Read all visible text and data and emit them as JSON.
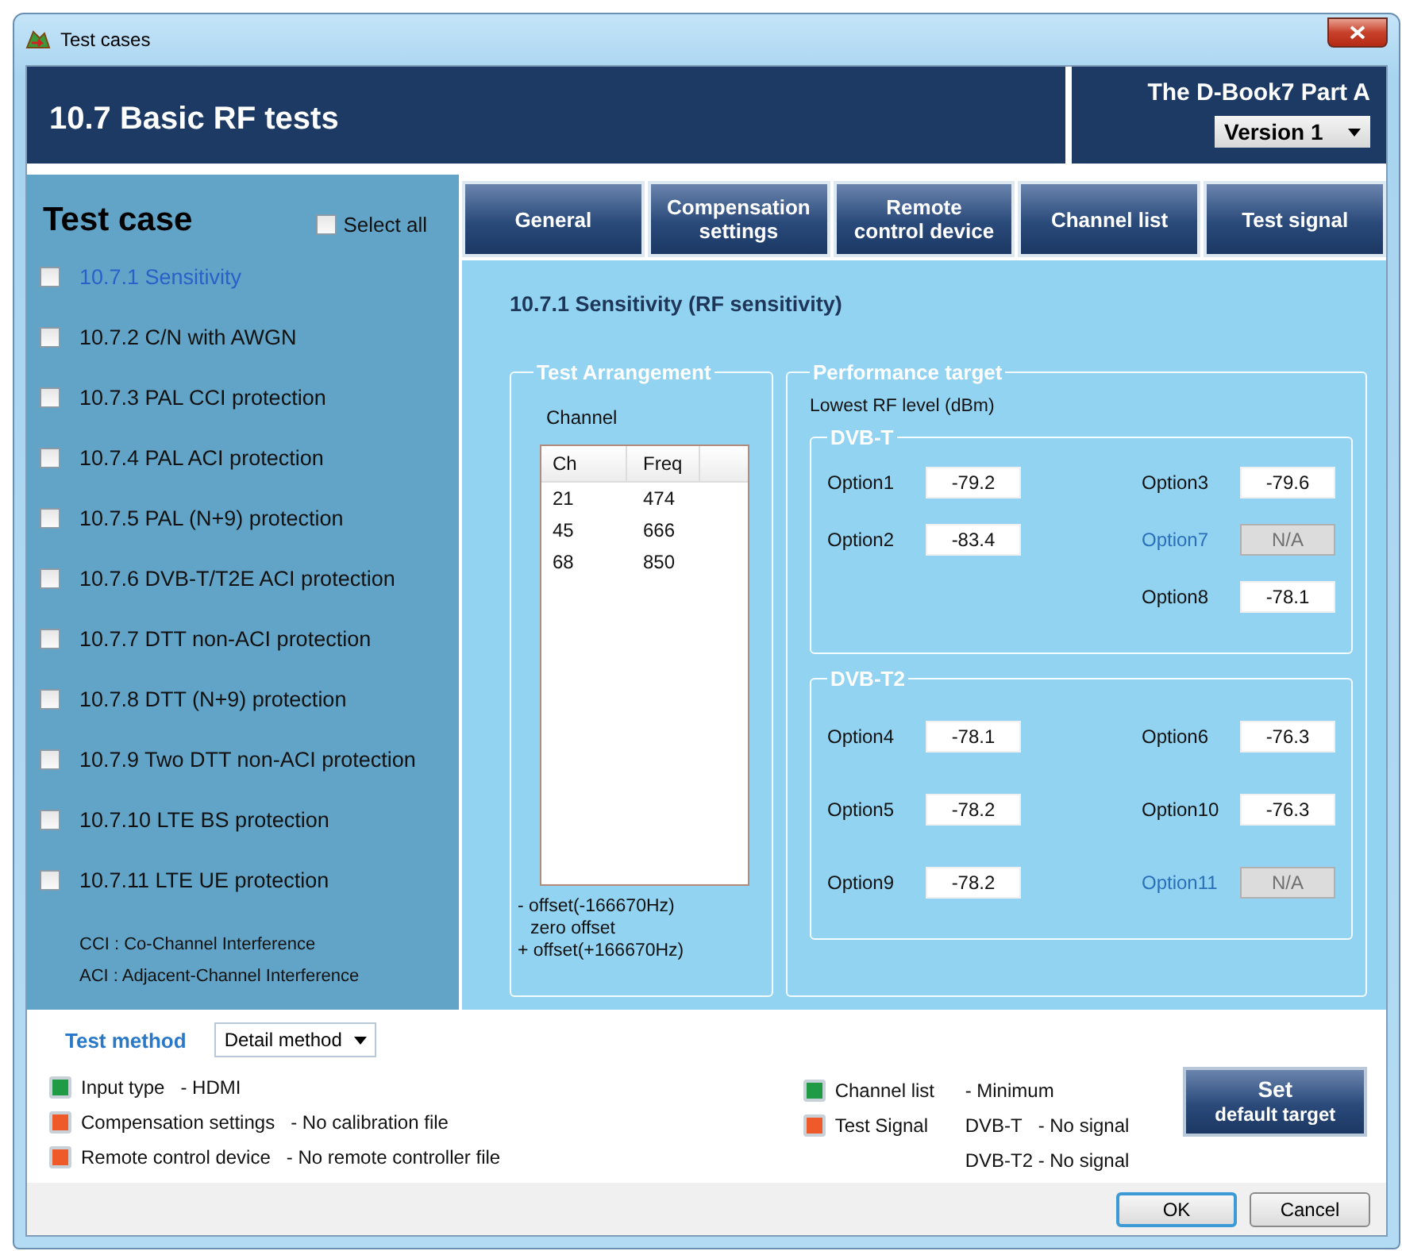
{
  "window": {
    "title": "Test cases"
  },
  "header": {
    "title": "10.7 Basic RF tests",
    "book": "The D-Book7 Part A",
    "version": "Version 1"
  },
  "sidebar": {
    "title": "Test case",
    "select_all": {
      "label": "Select all",
      "checked": false
    },
    "items": [
      {
        "label": "10.7.1 Sensitivity",
        "checked": false,
        "selected": true
      },
      {
        "label": "10.7.2 C/N with AWGN",
        "checked": false,
        "selected": false
      },
      {
        "label": "10.7.3 PAL CCI protection",
        "checked": false,
        "selected": false
      },
      {
        "label": "10.7.4 PAL ACI protection",
        "checked": false,
        "selected": false
      },
      {
        "label": "10.7.5 PAL (N+9) protection",
        "checked": false,
        "selected": false
      },
      {
        "label": "10.7.6 DVB-T/T2E ACI protection",
        "checked": false,
        "selected": false
      },
      {
        "label": "10.7.7 DTT non-ACI protection",
        "checked": false,
        "selected": false
      },
      {
        "label": "10.7.8 DTT (N+9) protection",
        "checked": false,
        "selected": false
      },
      {
        "label": "10.7.9 Two DTT non-ACI protection",
        "checked": false,
        "selected": false
      },
      {
        "label": "10.7.10 LTE BS protection",
        "checked": false,
        "selected": false
      },
      {
        "label": "10.7.11 LTE UE protection",
        "checked": false,
        "selected": false
      }
    ],
    "notes": [
      "CCI : Co-Channel Interference",
      "ACI : Adjacent-Channel Interference"
    ]
  },
  "tabs": [
    {
      "label": "General",
      "selected": false
    },
    {
      "label": "Compensation settings",
      "selected": false
    },
    {
      "label": "Remote control device",
      "selected": false
    },
    {
      "label": "Channel list",
      "selected": false
    },
    {
      "label": "Test signal",
      "selected": false
    }
  ],
  "content": {
    "title": "10.7.1 Sensitivity (RF sensitivity)",
    "arrangement": {
      "legend": "Test Arrangement",
      "channel_label": "Channel",
      "columns": [
        "Ch",
        "Freq"
      ],
      "rows": [
        [
          "21",
          "474"
        ],
        [
          "45",
          "666"
        ],
        [
          "68",
          "850"
        ]
      ],
      "notes": [
        "- offset(-166670Hz)",
        "zero offset",
        "+ offset(+166670Hz)"
      ]
    },
    "performance": {
      "legend": "Performance target",
      "subtitle": "Lowest RF level (dBm)",
      "groups": [
        {
          "legend": "DVB-T",
          "columns": [
            [
              {
                "label": "Option1",
                "value": "-79.2",
                "disabled": false
              },
              {
                "label": "Option2",
                "value": "-83.4",
                "disabled": false
              }
            ],
            [
              {
                "label": "Option3",
                "value": "-79.6",
                "disabled": false
              },
              {
                "label": "Option7",
                "value": "N/A",
                "disabled": true
              },
              {
                "label": "Option8",
                "value": "-78.1",
                "disabled": false
              }
            ]
          ]
        },
        {
          "legend": "DVB-T2",
          "columns": [
            [
              {
                "label": "Option4",
                "value": "-78.1",
                "disabled": false
              },
              {
                "label": "Option5",
                "value": "-78.2",
                "disabled": false
              },
              {
                "label": "Option9",
                "value": "-78.2",
                "disabled": false
              }
            ],
            [
              {
                "label": "Option6",
                "value": "-76.3",
                "disabled": false
              },
              {
                "label": "Option10",
                "value": "-76.3",
                "disabled": false
              },
              {
                "label": "Option11",
                "value": "N/A",
                "disabled": true
              }
            ]
          ]
        }
      ]
    }
  },
  "test_method": {
    "label": "Test method",
    "value": "Detail method"
  },
  "status_left": [
    {
      "name": "Input type",
      "detail": "- HDMI",
      "color": "#1f9a45"
    },
    {
      "name": "Compensation settings",
      "detail": "- No calibration file",
      "color": "#ef5a2a"
    },
    {
      "name": "Remote control device",
      "detail": "- No remote controller file",
      "color": "#ef5a2a"
    }
  ],
  "status_right": [
    {
      "name": "Channel list",
      "color": "#1f9a45",
      "lines": [
        {
          "value": "- Minimum"
        }
      ]
    },
    {
      "name": "Test Signal",
      "color": "#ef5a2a",
      "lines": [
        {
          "label": "DVB-T",
          "value": "- No signal"
        },
        {
          "label": "DVB-T2",
          "value": "- No signal"
        }
      ]
    }
  ],
  "default_button": [
    "Set",
    "default target"
  ],
  "buttons": [
    {
      "label": "OK",
      "default": true
    },
    {
      "label": "Cancel",
      "default": false
    }
  ]
}
